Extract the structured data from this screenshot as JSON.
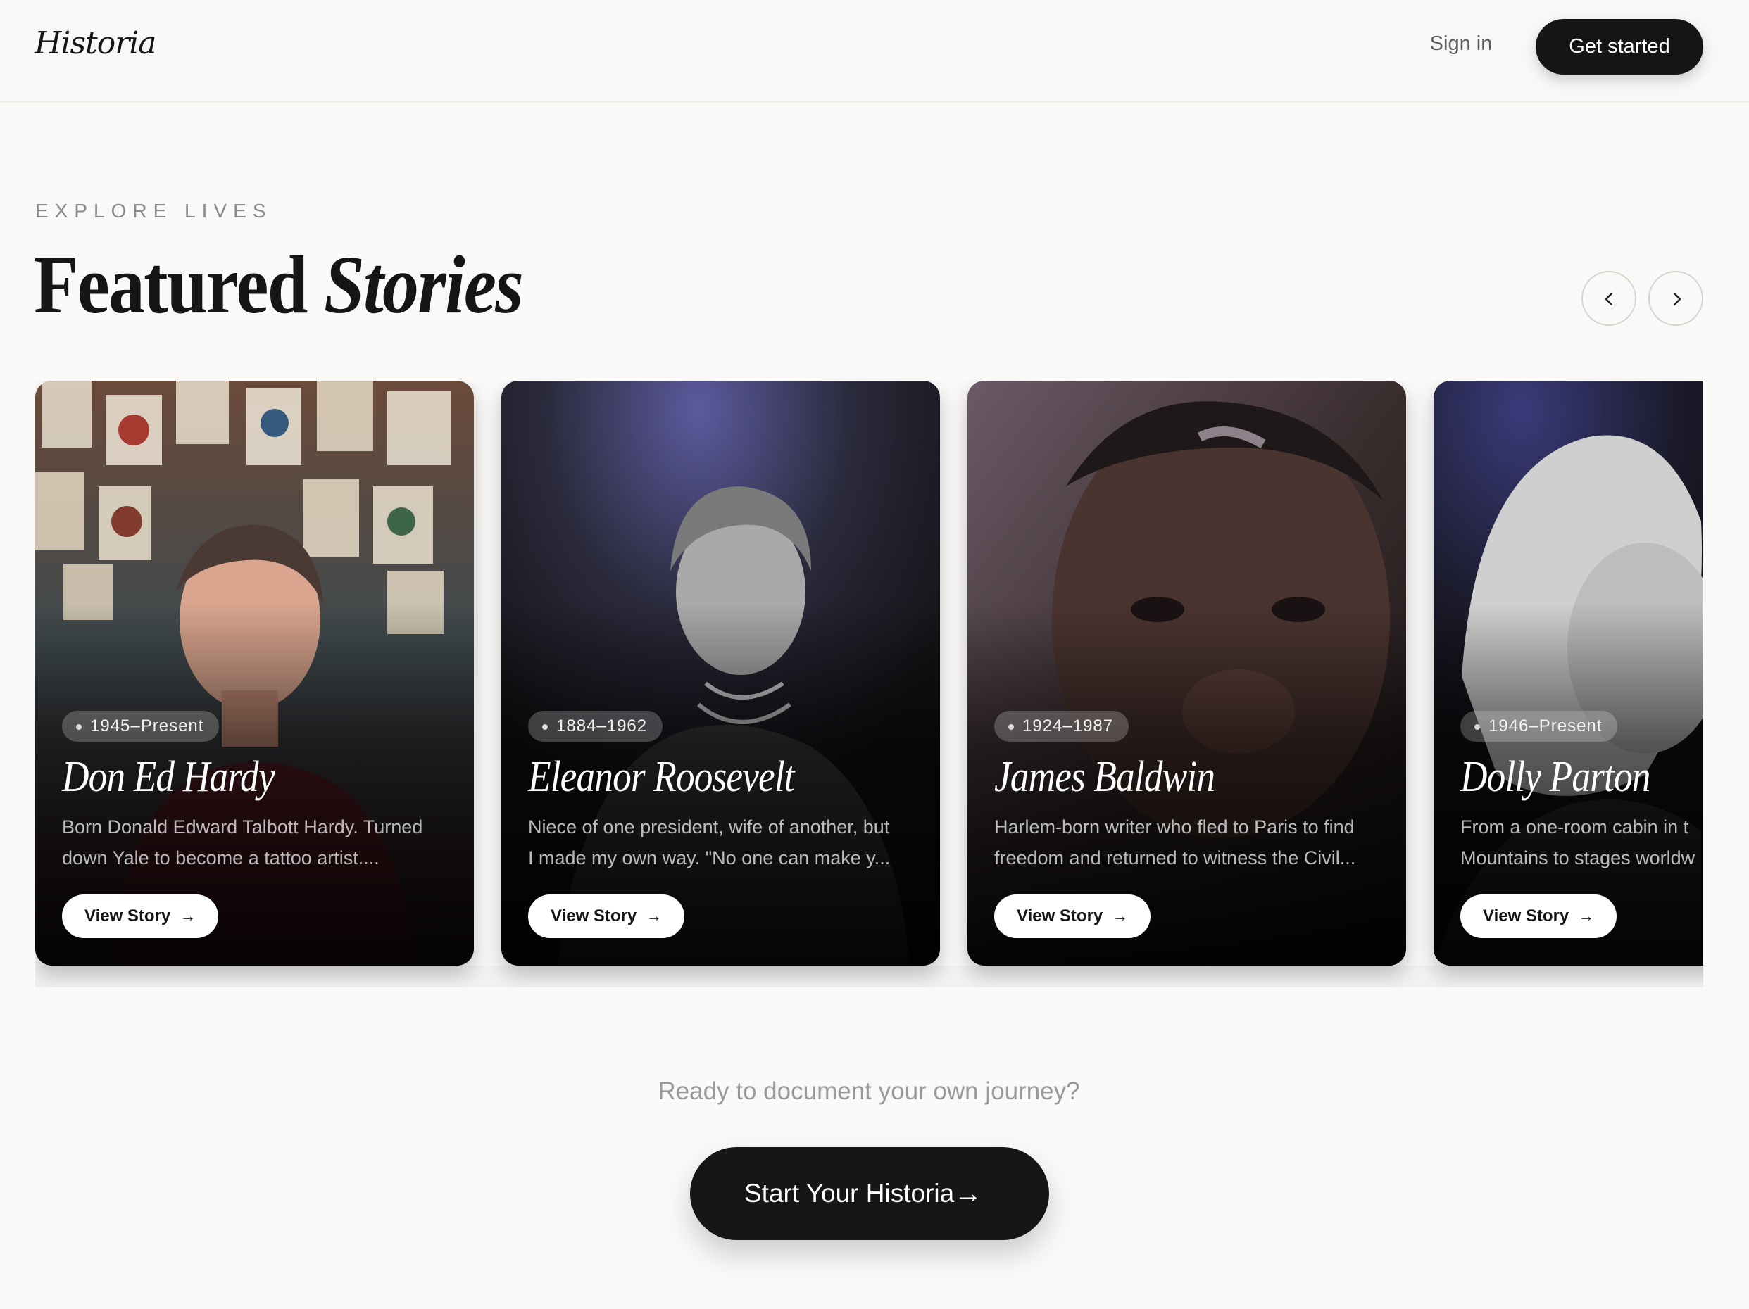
{
  "header": {
    "logo": "Historia",
    "sign_in": "Sign in",
    "get_started": "Get started"
  },
  "section": {
    "eyebrow": "EXPLORE LIVES",
    "title_plain": "Featured",
    "title_italic": "Stories"
  },
  "carousel": {
    "prev_icon": "chevron-left-icon",
    "next_icon": "chevron-right-icon",
    "cards": [
      {
        "years": "1945–Present",
        "name": "Don Ed Hardy",
        "desc_line1": "Born Donald Edward Talbott Hardy. Turned",
        "desc_line2": "down Yale to become a tattoo artist....",
        "cta": "View Story"
      },
      {
        "years": "1884–1962",
        "name": "Eleanor Roosevelt",
        "desc_line1": "Niece of one president, wife of another, but",
        "desc_line2": "I made my own way. \"No one can make y...",
        "cta": "View Story"
      },
      {
        "years": "1924–1987",
        "name": "James Baldwin",
        "desc_line1": "Harlem-born writer who fled to Paris to find",
        "desc_line2": "freedom and returned to witness the Civil...",
        "cta": "View Story"
      },
      {
        "years": "1946–Present",
        "name": "Dolly Parton",
        "desc_line1": "From a one-room cabin in t",
        "desc_line2": "Mountains to stages worldw",
        "cta": "View Story"
      }
    ]
  },
  "cta": {
    "question": "Ready to document your own journey?",
    "button": "Start Your Historia",
    "arrow": "→"
  },
  "colors": {
    "background": "#faf9f7",
    "primary_dark": "#151515",
    "muted_text": "#8b8b8b"
  }
}
